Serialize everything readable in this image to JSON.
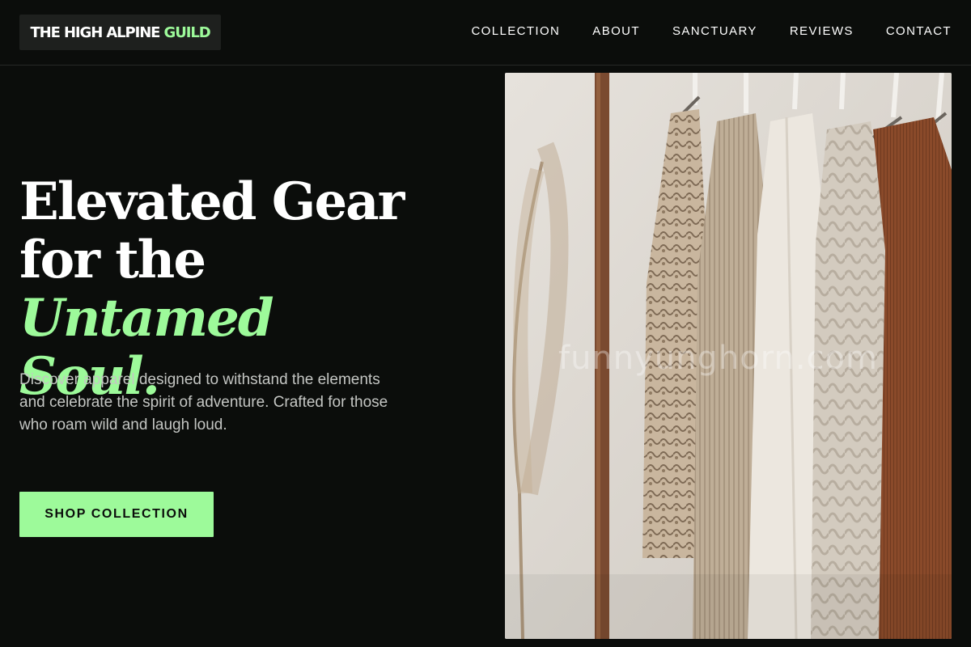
{
  "brand": {
    "name_main": "THE HIGH ALPINE ",
    "name_accent": "GUILD"
  },
  "nav": {
    "items": [
      {
        "label": "COLLECTION",
        "name": "nav-link-collection"
      },
      {
        "label": "ABOUT",
        "name": "nav-link-about"
      },
      {
        "label": "SANCTUARY",
        "name": "nav-link-sanctuary"
      },
      {
        "label": "REVIEWS",
        "name": "nav-link-reviews"
      },
      {
        "label": "CONTACT",
        "name": "nav-link-contact"
      }
    ]
  },
  "hero": {
    "title_line1": "Elevated Gear",
    "title_line2_plain": "for the ",
    "title_line2_accent": "Untamed",
    "title_line3_accent": "Soul.",
    "description": "Discover apparel designed to withstand the elements and celebrate the spirit of adventure. Crafted for those who roam wild and laugh loud.",
    "cta_label": "SHOP COLLECTION",
    "image_watermark": "funnyunghorn.com"
  },
  "colors": {
    "background": "#0b0d0b",
    "accent": "#9dfa9a",
    "logo_background": "#1e201e",
    "body_text": "#c4c6c3"
  }
}
